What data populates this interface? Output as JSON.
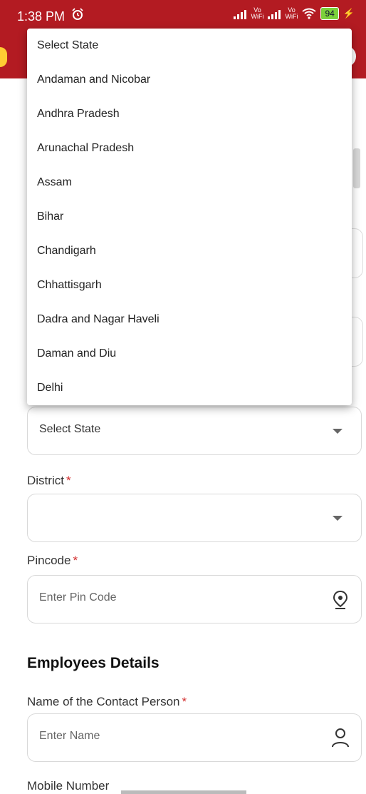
{
  "status_bar": {
    "time": "1:38 PM",
    "vo_wifi_1": "Vo\nWiFi",
    "vo_wifi_2": "Vo\nWiFi",
    "battery": "94"
  },
  "dropdown": {
    "items": [
      "Select State",
      "Andaman and Nicobar",
      "Andhra Pradesh",
      "Arunachal Pradesh",
      "Assam",
      "Bihar",
      "Chandigarh",
      "Chhattisgarh",
      "Dadra and Nagar Haveli",
      "Daman and Diu",
      "Delhi"
    ]
  },
  "form": {
    "state_select_value": "Select State",
    "district_label": "District",
    "district_value": "",
    "pincode_label": "Pincode",
    "pincode_placeholder": "Enter Pin Code",
    "section_title": "Employees Details",
    "contact_label": "Name of the Contact Person",
    "contact_placeholder": "Enter Name",
    "mobile_label": "Mobile Number",
    "required_mark": "*"
  },
  "colors": {
    "appbar": "#b31b22",
    "required": "#d32f2f"
  }
}
